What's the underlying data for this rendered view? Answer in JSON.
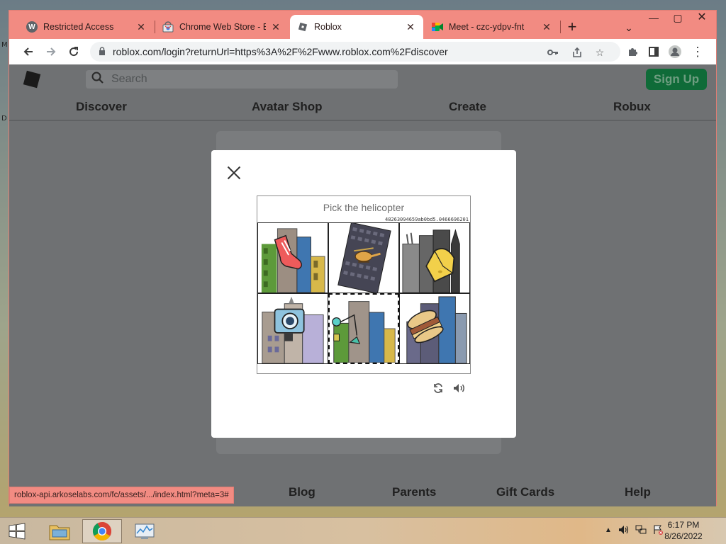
{
  "desktop": {
    "edge_letters": [
      "M",
      "D"
    ]
  },
  "browser": {
    "tabs": [
      {
        "title": "Restricted Access",
        "favicon": "W",
        "icon": "wiki-favicon"
      },
      {
        "title": "Chrome Web Store - Ex",
        "favicon": "",
        "icon": "webstore-favicon"
      },
      {
        "title": "Roblox",
        "favicon": "",
        "icon": "roblox-favicon"
      },
      {
        "title": "Meet - czc-ydpv-fnt",
        "favicon": "",
        "icon": "meet-favicon"
      }
    ],
    "active_tab": 2,
    "url": "roblox.com/login?returnUrl=https%3A%2F%2Fwww.roblox.com%2Fdiscover",
    "status_url": "roblox-api.arkoselabs.com/fc/assets/.../index.html?meta=3#"
  },
  "roblox": {
    "search_placeholder": "Search",
    "signup_label": "Sign Up",
    "nav": [
      "Discover",
      "Avatar Shop",
      "Create",
      "Robux"
    ],
    "footer": [
      "Blog",
      "Parents",
      "Gift Cards",
      "Help"
    ]
  },
  "captcha": {
    "prompt": "Pick the helicopter",
    "id_text": "48263094659ab0bd5.0466696201",
    "tiles": [
      "sock",
      "helicopter",
      "cheese",
      "camera",
      "crane",
      "burger"
    ],
    "selected_tile": 4
  },
  "taskbar": {
    "time": "6:17 PM",
    "date": "8/26/2022"
  },
  "colors": {
    "browser_frame": "#f28b82",
    "signup_bg": "#0f6b38",
    "page_overlay": "#6f7173"
  }
}
